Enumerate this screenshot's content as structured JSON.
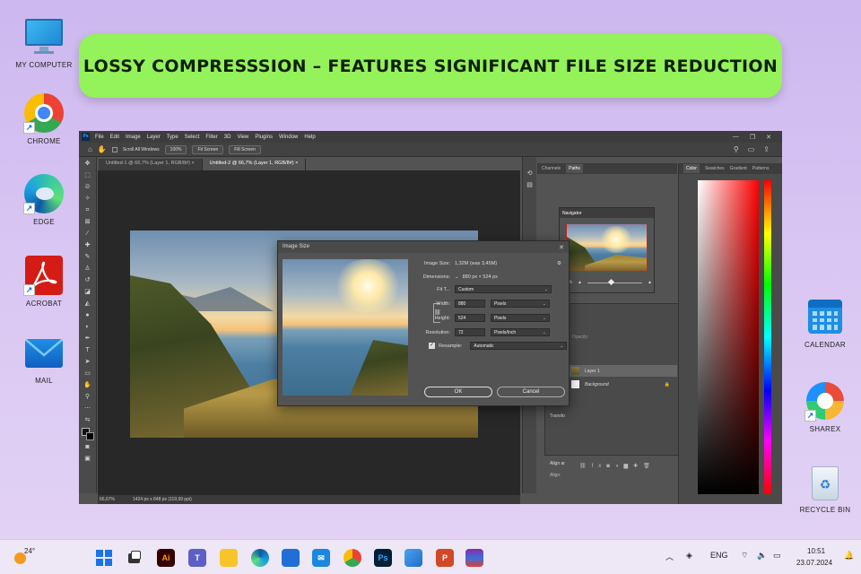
{
  "banner": {
    "title": "LOSSY COMPRESSSION – FEATURES SIGNIFICANT FILE SIZE REDUCTION"
  },
  "desktop": {
    "left_icons": [
      {
        "label": "MY COMPUTER",
        "icon": "monitor-icon"
      },
      {
        "label": "CHROME",
        "icon": "chrome-icon"
      },
      {
        "label": "EDGE",
        "icon": "edge-icon"
      },
      {
        "label": "ACROBAT",
        "icon": "acrobat-icon"
      },
      {
        "label": "MAIL",
        "icon": "mail-icon"
      }
    ],
    "right_icons": [
      {
        "label": "CALENDAR",
        "icon": "calendar-icon"
      },
      {
        "label": "SHAREX",
        "icon": "sharex-icon"
      },
      {
        "label": "RECYCLE BIN",
        "icon": "recycle-bin-icon"
      }
    ]
  },
  "photoshop": {
    "logo": "Ps",
    "menu": [
      "File",
      "Edit",
      "Image",
      "Layer",
      "Type",
      "Select",
      "Filter",
      "3D",
      "View",
      "Plugins",
      "Window",
      "Help"
    ],
    "options": {
      "scroll_all": "Scroll All Windows",
      "zoom": "100%",
      "fit": "Fit Screen",
      "fill": "Fill Screen"
    },
    "tabs": [
      "Untitled-1 @ 66,7% (Layer 1, RGB/8#) ×",
      "Untitled-2 @ 66,7% (Layer 1, RGB/8#) ×"
    ],
    "status": {
      "zoom": "66,67%",
      "doc": "1424 px x 848 px (119,99 ppi)"
    },
    "panels": {
      "channels": "Channels",
      "paths": "Paths",
      "navigator": "Navigator",
      "nav_zoom": "67%",
      "color_tabs": [
        "Color",
        "Swatches",
        "Gradient",
        "Patterns"
      ],
      "opacity_label": "Opacity:",
      "layers": [
        {
          "name": "Layer 1"
        },
        {
          "name": "Background"
        }
      ],
      "transform": "Transfo",
      "align": "Align ar",
      "align_sub": "Align:"
    },
    "dialog": {
      "title": "Image Size",
      "image_size_label": "Image Size:",
      "image_size_value": "1,32M (was 3,45M)",
      "dimensions_label": "Dimensions:",
      "dimensions_value": "880 px  ×  524 px",
      "fit_label": "Fit T...",
      "fit_value": "Custom",
      "width_label": "Width:",
      "width_value": "880",
      "width_unit": "Pixels",
      "height_label": "Height:",
      "height_value": "524",
      "height_unit": "Pixels",
      "resolution_label": "Resolution:",
      "resolution_value": "72",
      "resolution_unit": "Pixels/Inch",
      "resample_label": "Resample:",
      "resample_value": "Automatic",
      "ok": "OK",
      "cancel": "Cancel"
    }
  },
  "taskbar": {
    "weather": "24°",
    "lang": "ENG",
    "time": "10:51",
    "date": "23.07.2024"
  }
}
